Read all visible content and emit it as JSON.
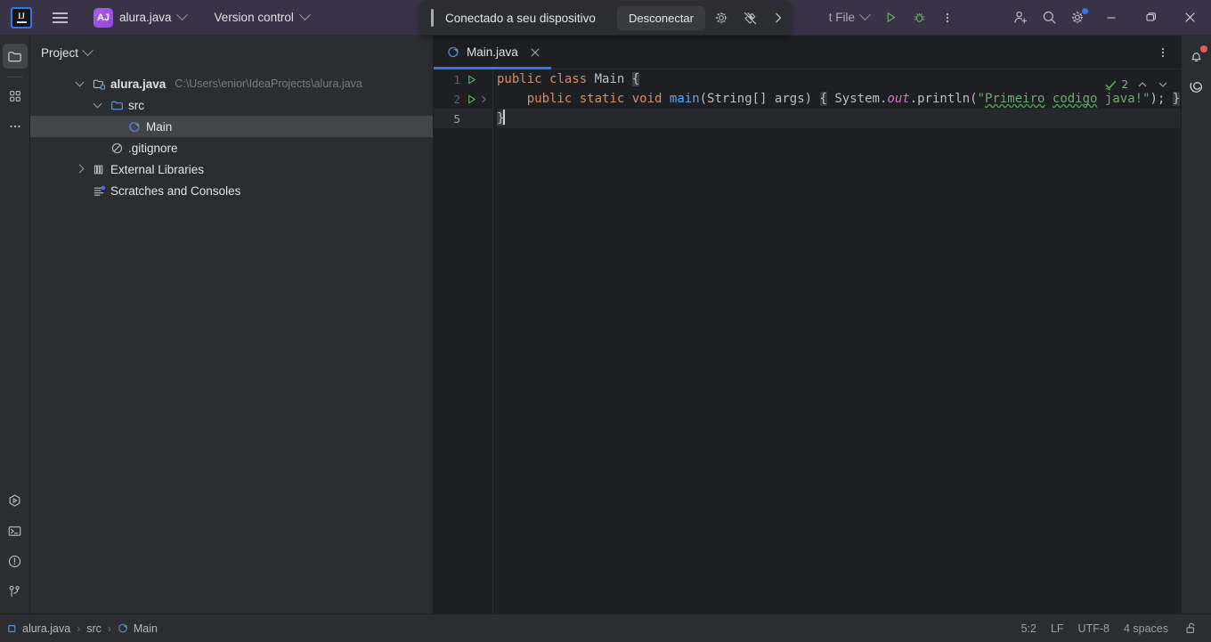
{
  "titlebar": {
    "logo_alt": "IJ",
    "project_initials": "AJ",
    "project_name": "alura.java",
    "vcs_label": "Version control",
    "run_config_label": "t File",
    "run_tooltip": "Run",
    "debug_tooltip": "Debug",
    "more_tooltip": "More",
    "window": {
      "minimize": "—",
      "maximize": "❐",
      "close": "✕"
    }
  },
  "connect_popup": {
    "message": "Conectado a seu dispositivo",
    "button_label": "Desconectar",
    "settings_icon": "gear-icon",
    "pin_icon": "pin-off-icon",
    "expand_icon": "chevron-right-icon"
  },
  "left_stripe": {
    "top": [
      {
        "name": "project-tool-window",
        "icon": "folder-icon",
        "active": true
      },
      {
        "name": "commit-tool-window",
        "icon": "grid-icon",
        "active": false
      },
      {
        "name": "more-tool-windows",
        "icon": "ellipsis-icon",
        "active": false
      }
    ],
    "bottom": [
      {
        "name": "run-tool-window",
        "icon": "run-hex-icon"
      },
      {
        "name": "terminal-tool-window",
        "icon": "terminal-icon"
      },
      {
        "name": "problems-tool-window",
        "icon": "warning-circle-icon"
      },
      {
        "name": "version-control-tool-window",
        "icon": "branch-icon"
      }
    ]
  },
  "right_stripe": [
    {
      "name": "notifications",
      "icon": "bell-icon",
      "badge": true
    },
    {
      "name": "ai-assistant",
      "icon": "spiral-icon",
      "badge": false
    }
  ],
  "project_panel": {
    "title": "Project",
    "tree": [
      {
        "label": "alura.java",
        "path": "C:\\Users\\enior\\IdeaProjects\\alura.java",
        "icon": "module-icon",
        "indent": 0,
        "twisty": "down",
        "bold": true,
        "selected": false
      },
      {
        "label": "src",
        "path": "",
        "icon": "source-folder-icon",
        "indent": 1,
        "twisty": "down",
        "bold": false,
        "selected": false
      },
      {
        "label": "Main",
        "path": "",
        "icon": "java-class-runnable-icon",
        "indent": 2,
        "twisty": "none",
        "bold": false,
        "selected": true
      },
      {
        "label": ".gitignore",
        "path": "",
        "icon": "gitignore-icon",
        "indent": 1,
        "twisty": "none",
        "bold": false,
        "selected": false
      },
      {
        "label": "External Libraries",
        "path": "",
        "icon": "library-icon",
        "indent": 0,
        "twisty": "right",
        "bold": false,
        "selected": false
      },
      {
        "label": "Scratches and Consoles",
        "path": "",
        "icon": "scratches-icon",
        "indent": 0,
        "twisty": "none",
        "bold": false,
        "selected": false
      }
    ]
  },
  "editor": {
    "tab": {
      "label": "Main.java",
      "icon": "java-class-runnable-icon",
      "close": "✕"
    },
    "options_icon": "vertical-ellipsis-icon",
    "lines": [
      {
        "num": "1",
        "run_icon": true,
        "fold_icon": false,
        "current": false
      },
      {
        "num": "2",
        "run_icon": true,
        "fold_icon": true,
        "current": false
      },
      {
        "num": "5",
        "run_icon": false,
        "fold_icon": false,
        "current": true
      }
    ],
    "code": {
      "line1": {
        "kw_public": "public",
        "kw_class": "class",
        "name": "Main",
        "brace": "{"
      },
      "line2": {
        "kw_public": "public",
        "kw_static": "static",
        "kw_void": "void",
        "method": "main",
        "params": "(String[] args)",
        "fold_open": "{",
        "sys": "System",
        "dot1": ".",
        "out": "out",
        "dot2": ".",
        "println": "println",
        "paren_open": "(",
        "quote_open": "\"",
        "str_word1": "Primeiro",
        "str_space1": " ",
        "str_word2": "codigo",
        "str_space2": " ",
        "str_word3": "java!",
        "quote_close": "\"",
        "paren_close": ")",
        "semi": ";",
        "fold_close": "}"
      },
      "line5": {
        "brace": "}"
      }
    },
    "inspection": {
      "status_icon": "green-check-icon",
      "count": "2",
      "prev_icon": "chevron-up-icon",
      "next_icon": "chevron-down-icon"
    }
  },
  "statusbar": {
    "breadcrumb": [
      {
        "label": "alura.java",
        "icon": "module-small-icon"
      },
      {
        "label": "src",
        "icon": "none"
      },
      {
        "label": "Main",
        "icon": "java-class-runnable-icon"
      }
    ],
    "separator": "›",
    "caret_position": "5:2",
    "line_separator": "LF",
    "encoding": "UTF-8",
    "indent": "4 spaces",
    "lock_icon": "unlocked-icon"
  },
  "colors": {
    "titlebar_bg": "#3a3347",
    "panel_bg": "#2b2d30",
    "editor_bg": "#1e1f22",
    "accent_blue": "#3574f0",
    "selection": "#43454a",
    "keyword_orange": "#cf8e6d",
    "method_blue": "#56a8f5",
    "string_green": "#6aab73",
    "field_purple": "#c77dbb",
    "run_green": "#59a869",
    "badge_red": "#e55765",
    "project_badge": "#a055d8"
  }
}
